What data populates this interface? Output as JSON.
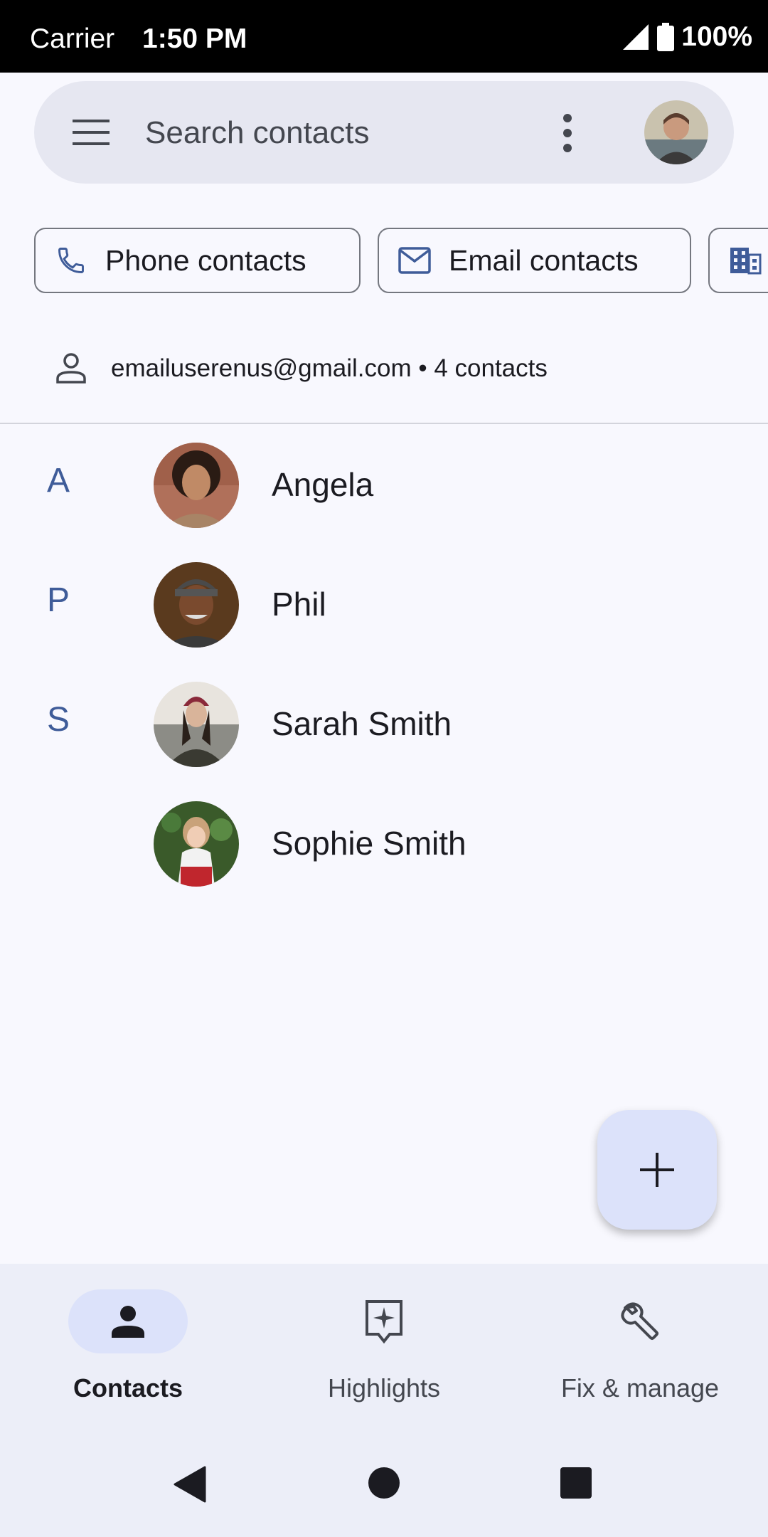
{
  "status_bar": {
    "carrier": "Carrier",
    "time": "1:50 PM",
    "battery": "100%"
  },
  "search": {
    "placeholder": "Search contacts"
  },
  "filters": [
    {
      "label": "Phone contacts",
      "icon": "phone-icon"
    },
    {
      "label": "Email contacts",
      "icon": "mail-icon"
    },
    {
      "label": "",
      "icon": "organization-icon"
    }
  ],
  "account": {
    "summary": "emailuserenus@gmail.com • 4 contacts"
  },
  "contacts": [
    {
      "letter": "A",
      "name": "Angela"
    },
    {
      "letter": "P",
      "name": "Phil"
    },
    {
      "letter": "S",
      "name": "Sarah Smith"
    },
    {
      "letter": "",
      "name": "Sophie Smith"
    }
  ],
  "bottom_nav": [
    {
      "label": "Contacts",
      "icon": "person-icon",
      "active": true
    },
    {
      "label": "Highlights",
      "icon": "highlights-icon",
      "active": false
    },
    {
      "label": "Fix & manage",
      "icon": "wrench-icon",
      "active": false
    }
  ],
  "colors": {
    "accent": "#3f5c99",
    "fab_bg": "#dce2fa",
    "search_bg": "#e6e7f1",
    "nav_bg": "#eceef8"
  }
}
